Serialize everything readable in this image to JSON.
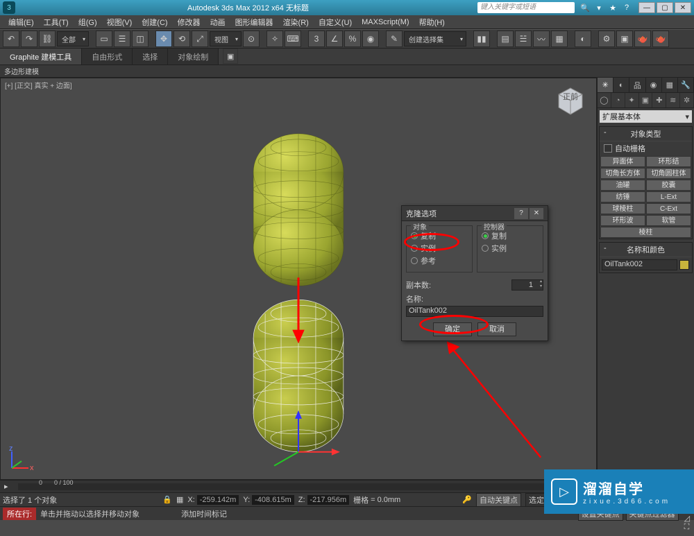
{
  "app": {
    "title": "Autodesk 3ds Max 2012 x64    无标题"
  },
  "search": {
    "placeholder": "键入关键字或短语"
  },
  "menu": [
    "编辑(E)",
    "工具(T)",
    "组(G)",
    "视图(V)",
    "创建(C)",
    "修改器",
    "动画",
    "图形编辑器",
    "渲染(R)",
    "自定义(U)",
    "MAXScript(M)",
    "帮助(H)"
  ],
  "toolbar": {
    "all_dropdown": "全部",
    "view_dropdown": "视图",
    "selset_dropdown": "创建选择集"
  },
  "ribbon": {
    "tabs": [
      "Graphite 建模工具",
      "自由形式",
      "选择",
      "对象绘制"
    ],
    "sub": "多边形建模"
  },
  "viewport": {
    "label": "[+] [正交] 真实 + 边面]"
  },
  "cmdpanel": {
    "category": "扩展基本体",
    "obj_type_title": "对象类型",
    "autogrid": "自动栅格",
    "buttons_col1": [
      "异面体",
      "切角长方体",
      "油罐",
      "纺锤",
      "球棱柱",
      "环形波",
      "棱柱"
    ],
    "buttons_col2": [
      "环形结",
      "切角圆柱体",
      "胶囊",
      "L-Ext",
      "C-Ext",
      "软管",
      ""
    ],
    "name_color_title": "名称和颜色",
    "object_name": "OilTank002"
  },
  "dialog": {
    "title": "克隆选项",
    "grp_obj": "对象",
    "grp_ctrl": "控制器",
    "r_copy": "复制",
    "r_inst": "实例",
    "r_ref": "参考",
    "copies_lbl": "副本数:",
    "copies_val": "1",
    "name_lbl": "名称:",
    "name_val": "OilTank002",
    "ok": "确定",
    "cancel": "取消"
  },
  "timeline": {
    "zero": "0",
    "hundred": "0 / 100"
  },
  "coords": {
    "x_lbl": "X:",
    "x": "-259.142m",
    "y_lbl": "Y:",
    "y": "-408.615m",
    "z_lbl": "Z:",
    "z": "-217.956m",
    "grid_lbl": "栅格",
    "grid": "= 0.0mm",
    "auto_key": "自动关键点",
    "sel_set": "选定对象"
  },
  "status": {
    "sel": "选择了 1 个对象",
    "hint": "单击并拖动以选择并移动对象",
    "here": "所在行:",
    "add_time": "添加时间标记",
    "set_key": "设置关键点",
    "key_filter": "关键点过滤器"
  },
  "watermark": {
    "brand": "溜溜自学",
    "url": "zixue.3d66.com"
  }
}
